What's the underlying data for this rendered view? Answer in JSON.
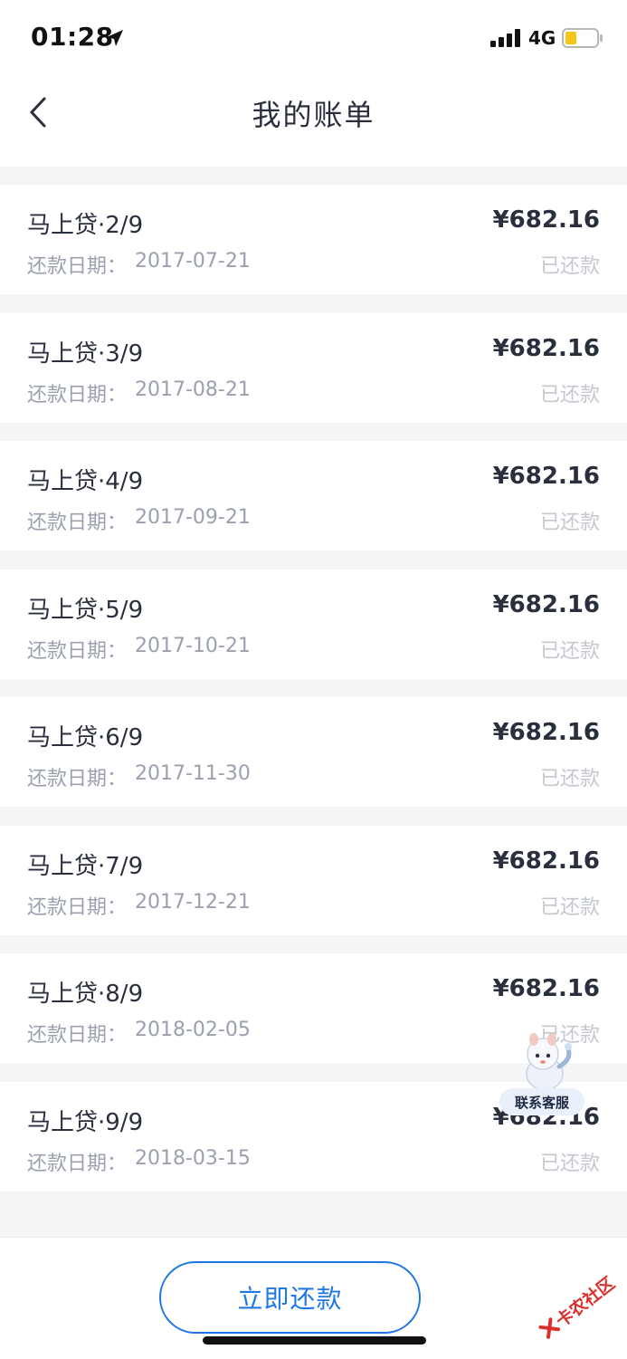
{
  "status_bar": {
    "time": "01:28",
    "network": "4G",
    "battery_color": "#f5c518"
  },
  "nav": {
    "title": "我的账单",
    "back_icon": "chevron-left-icon"
  },
  "bills": [
    {
      "name": "马上贷·2/9",
      "amount": "¥682.16",
      "date_label": "还款日期：",
      "date": "2017-07-21",
      "status": "已还款"
    },
    {
      "name": "马上贷·3/9",
      "amount": "¥682.16",
      "date_label": "还款日期：",
      "date": "2017-08-21",
      "status": "已还款"
    },
    {
      "name": "马上贷·4/9",
      "amount": "¥682.16",
      "date_label": "还款日期：",
      "date": "2017-09-21",
      "status": "已还款"
    },
    {
      "name": "马上贷·5/9",
      "amount": "¥682.16",
      "date_label": "还款日期：",
      "date": "2017-10-21",
      "status": "已还款"
    },
    {
      "name": "马上贷·6/9",
      "amount": "¥682.16",
      "date_label": "还款日期：",
      "date": "2017-11-30",
      "status": "已还款"
    },
    {
      "name": "马上贷·7/9",
      "amount": "¥682.16",
      "date_label": "还款日期：",
      "date": "2017-12-21",
      "status": "已还款"
    },
    {
      "name": "马上贷·8/9",
      "amount": "¥682.16",
      "date_label": "还款日期：",
      "date": "2018-02-05",
      "status": "已还款"
    },
    {
      "name": "马上贷·9/9",
      "amount": "¥682.16",
      "date_label": "还款日期：",
      "date": "2018-03-15",
      "status": "已还款"
    }
  ],
  "customer_service": {
    "label": "联系客服",
    "icon": "mascot-icon"
  },
  "footer": {
    "pay_button_label": "立即还款"
  },
  "watermark": {
    "text": "卡农社区"
  },
  "colors": {
    "accent": "#1f78e6",
    "text_primary": "#2a2f3d",
    "text_secondary": "#9aa0ad",
    "text_muted": "#c3c7cf",
    "background": "#f4f5f7"
  }
}
